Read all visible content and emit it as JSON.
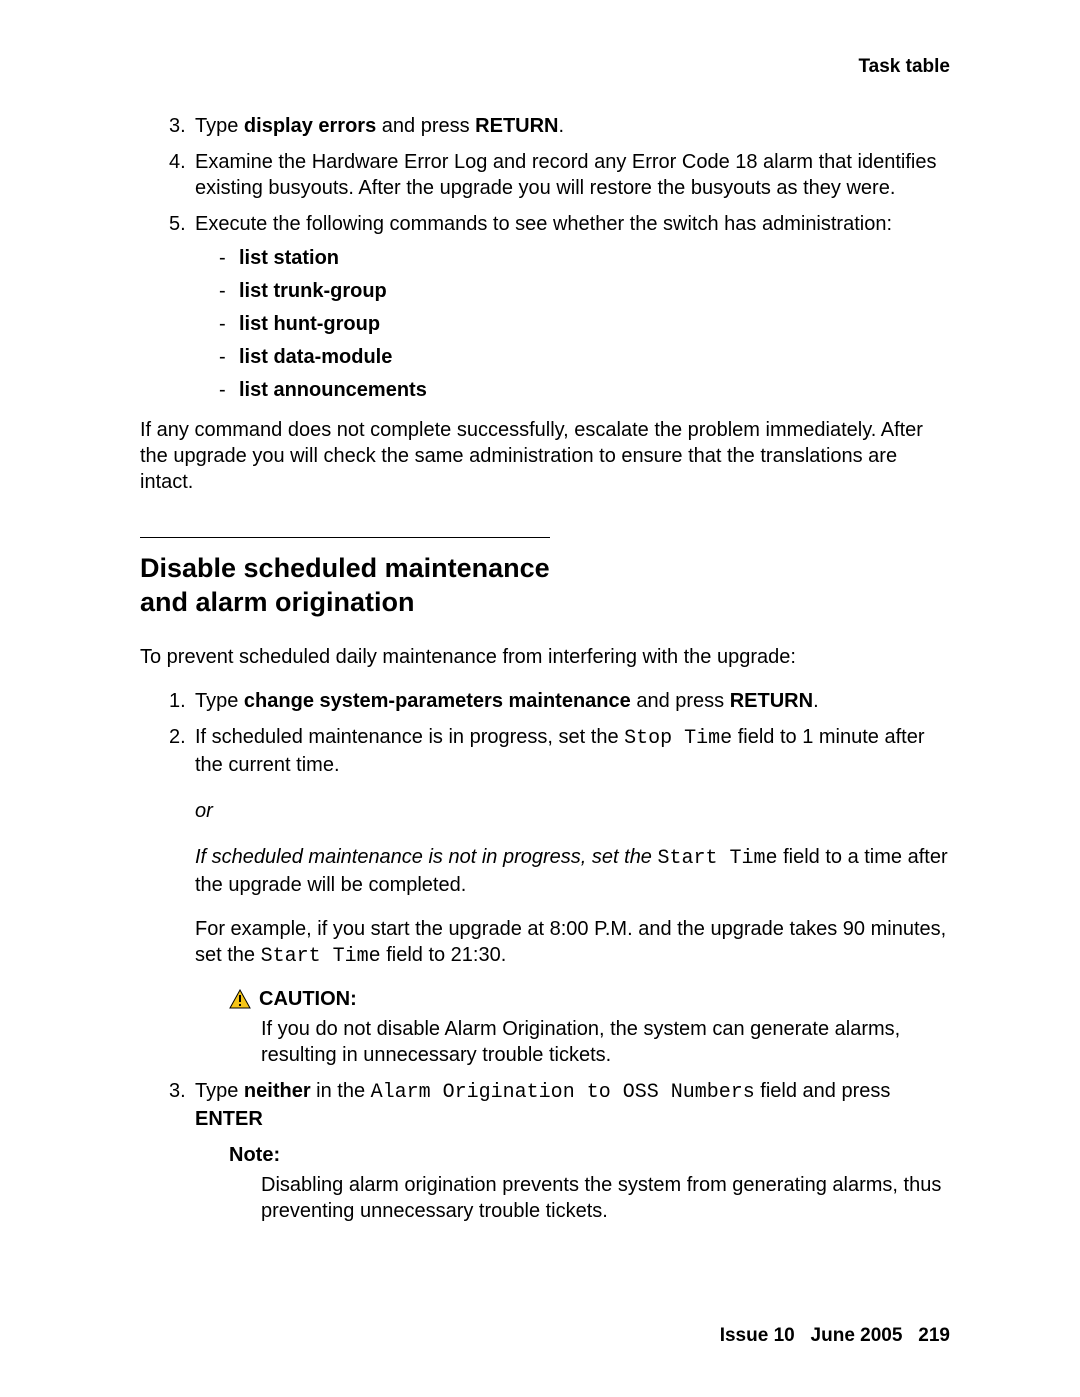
{
  "header": {
    "right": "Task table"
  },
  "section1": {
    "items": [
      {
        "num": "3.",
        "parts": [
          {
            "t": "Type "
          },
          {
            "t": "display errors",
            "b": true
          },
          {
            "t": " and press "
          },
          {
            "t": "RETURN",
            "b": true
          },
          {
            "t": "."
          }
        ]
      },
      {
        "num": "4.",
        "text": "Examine the Hardware Error Log and record any Error Code 18 alarm that identifies existing busyouts. After the upgrade you will restore the busyouts as they were."
      },
      {
        "num": "5.",
        "text": "Execute the following commands to see whether the switch has administration:",
        "bullets": [
          "list station",
          "list trunk-group",
          "list hunt-group",
          "list data-module",
          "list announcements"
        ]
      }
    ],
    "after": "If any command does not complete successfully, escalate the problem immediately. After the upgrade you will check the same administration to ensure that the translations are intact."
  },
  "section2": {
    "heading_l1": "Disable scheduled maintenance",
    "heading_l2": "and alarm origination",
    "intro": "To prevent scheduled daily maintenance from interfering with the upgrade:",
    "items": {
      "i1": {
        "num": "1.",
        "parts": [
          {
            "t": "Type "
          },
          {
            "t": "change system-parameters maintenance",
            "b": true
          },
          {
            "t": " and press "
          },
          {
            "t": "RETURN",
            "b": true
          },
          {
            "t": "."
          }
        ]
      },
      "i2": {
        "num": "2.",
        "parts_a": [
          {
            "t": "If scheduled maintenance is in progress, set the "
          },
          {
            "t": "Stop Time",
            "mono": true
          },
          {
            "t": " field to 1 minute after the current time."
          }
        ],
        "or": "or",
        "parts_b_pre": "If scheduled maintenance is not in progress, set the ",
        "parts_b_mono": "Start Time",
        "parts_b_post": " field to a time after the upgrade will be completed.",
        "example_pre": "For example, if you start the upgrade at 8:00 P.M. and the upgrade takes 90 minutes, set the ",
        "example_mono": "Start Time",
        "example_post": " field to 21:30.",
        "caution_label": "CAUTION:",
        "caution_body": "If you do not disable Alarm Origination, the system can generate alarms, resulting in unnecessary trouble tickets."
      },
      "i3": {
        "num": "3.",
        "parts": [
          {
            "t": "Type "
          },
          {
            "t": "neither",
            "b": true
          },
          {
            "t": " in the "
          },
          {
            "t": "Alarm Origination to OSS Numbers",
            "mono": true
          },
          {
            "t": " field and press "
          },
          {
            "t": "ENTER",
            "b": true
          }
        ],
        "note_label": "Note:",
        "note_body": "Disabling alarm origination prevents the system from generating alarms, thus preventing unnecessary trouble tickets."
      }
    }
  },
  "footer": {
    "issue": "Issue 10",
    "date": "June 2005",
    "page": "219"
  }
}
